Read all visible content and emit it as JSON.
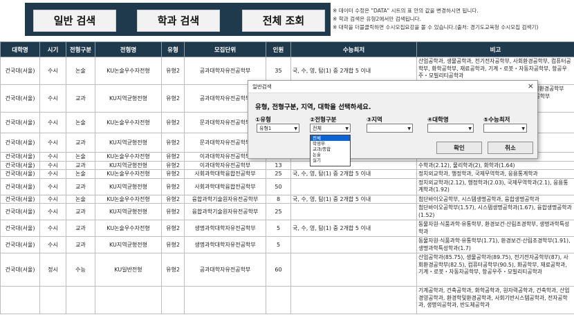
{
  "toolbar": {
    "buttons": [
      {
        "label": "일반 검색"
      },
      {
        "label": "학과 검색"
      },
      {
        "label": "전체 조회"
      }
    ]
  },
  "notes": [
    "※ 데이터 수정은 \"DATA\" 시트의 표 안의 값을 변경하시면 됩니다.",
    "※ 학과 검색은 유형2에서만 검색됩니다.",
    "※ 대학을 더블클릭하면 수시모집요강을 볼 수 있습니다.(출처: 경기도교육청 수시모집 검색기)"
  ],
  "table": {
    "headers": [
      "대학명",
      "시기",
      "전형구분",
      "전형명",
      "유형",
      "모집단위",
      "인원",
      "수능최저",
      "비고"
    ],
    "rows": [
      {
        "cells": [
          "건국대(서울)",
          "수시",
          "논술",
          "KU논술우수자전형",
          "유형2",
          "공과대학자유전공학부",
          "35",
          "국, 수, 영, 탐(1) 중 2개합 5 이내",
          "산업공학과, 생물공학과, 전기전자공학부, 사회환경공학부, 컴퓨터공학부, 화학공학부, 재료공학과, 기계・로봇・자동차공학부, 항공우주・모빌리티공학과"
        ],
        "h": 40
      },
      {
        "cells": [
          "건국대(서울)",
          "수시",
          "교과",
          "KU지역균형전형",
          "유형2",
          "공과대학자유전공학부",
          "",
          "",
          "산업공학과(2.19), 생물공학과, 전기전자공학부, 사회환경공학부(1.75), 화공학부, 재료공학과, 기계・로봇・자동차공학부"
        ],
        "h": 40
      },
      {
        "cells": [
          "건국대(서울)",
          "수시",
          "논술",
          "KU논술우수자전형",
          "유형2",
          "문과대학자유전공학부",
          "",
          "",
          "영어영문학과, 철학과, 사"
        ],
        "h": 30
      },
      {
        "cells": [
          "건국대(서울)",
          "수시",
          "교과",
          "KU지역균형전형",
          "유형2",
          "문과대학자유전공학부",
          "",
          "",
          "지리학과, 커뮤니케이션학과, 미디어중문학과(2.12)"
        ],
        "h": 28
      },
      {
        "cells": [
          "건국대(서울)",
          "수시",
          "논술",
          "KU논술우수자전형",
          "유형2",
          "이과대학자유전공학부",
          "11",
          "국, 수, 영, 탐(1) 중 2개합 5 이내",
          "수학과, 물리학과, 화학과"
        ],
        "h": 11
      },
      {
        "cells": [
          "건국대(서울)",
          "수시",
          "교과",
          "KU지역균형전형",
          "유형2",
          "이과대학자유전공학부",
          "13",
          "",
          "수학과(2.12), 물리학과(2), 화학과(1.64)"
        ],
        "h": 12
      },
      {
        "cells": [
          "건국대(서울)",
          "수시",
          "논술",
          "KU논술우수자전형",
          "유형2",
          "사회과학대학융합전공학부",
          "25",
          "국, 수, 영, 탐(1) 중 2개합 5 이내",
          "정치외교학과, 행정학과, 국제무역학과, 응용통계학과"
        ],
        "h": 12
      },
      {
        "cells": [
          "건국대(서울)",
          "수시",
          "교과",
          "KU지역균형전형",
          "유형2",
          "사회과학대학융합전공학부",
          "50",
          "",
          "정치외교학과(2.12), 행정학과(2.03), 국제무역학과(2.1), 응용통계학과(1.92)"
        ],
        "h": 24
      },
      {
        "cells": [
          "건국대(서울)",
          "수시",
          "논술",
          "KU논술우수자전형",
          "유형2",
          "융합과학기술원자유전공학부",
          "8",
          "국, 수, 영, 탐(1) 중 2개합 5 이내",
          "첨단바이오공학부, 시스템생명공학과, 융합생명공학과"
        ],
        "h": 12
      },
      {
        "cells": [
          "건국대(서울)",
          "수시",
          "교과",
          "KU지역균형전형",
          "유형2",
          "융합과학기술원자유전공학부",
          "25",
          "",
          "첨단바이오공학부(1.57), 시스템생명공학과(1.67), 융합생명공학과(1.52)"
        ],
        "h": 24
      },
      {
        "cells": [
          "건국대(서울)",
          "수시",
          "교과",
          "KU논술우수자전형",
          "유형2",
          "생명과학대학자유전공학부",
          "5",
          "국, 수, 영, 탐(1) 중 2개합 5 이내",
          "동물자원·식품과학·유통학부, 환경보건·산림조경학부, 생명과학특성학과"
        ],
        "h": 24
      },
      {
        "cells": [
          "건국대(서울)",
          "수시",
          "교과",
          "KU지역균형전형",
          "유형2",
          "생명과학대학자유전공학부",
          "5",
          "",
          "동물자원·식품과학·유통학부(1.71), 환경보건·산림조경학부(1.91), 생명과학특성학과(1.7)"
        ],
        "h": 24
      },
      {
        "cells": [
          "건국대(서울)",
          "정시",
          "수능",
          "KU일반전형",
          "유형2",
          "공과대학자유전공학부",
          "60",
          "",
          "산업공학과(85.75), 생물공학과(89.75), 전기전자공학부(87), 사회환경공학부(82.5), 컴퓨터공학부(90.5), 화공학부, 재료공학과, 기계・로봇・자동차공학부, 항공우주・모빌리티공학과"
        ],
        "h": 48
      },
      {
        "cells": [
          "",
          "",
          "",
          "",
          "",
          "",
          "",
          "",
          "기계공학과, 건축공학과, 화학공학과, 원자력공학과, 건축학과, 산업경영공학과, 환경학및환경공학과, 사회기반시스템공학과, 전자공학과, 생명의공학과, 반도체공학과"
        ],
        "h": 40
      }
    ]
  },
  "dialog": {
    "title": "일반검색",
    "close": "×",
    "instruction": "유형, 전형구분, 지역, 대학을 선택하세요.",
    "fields": [
      {
        "label": "①유형",
        "value": "유형1"
      },
      {
        "label": "②전형구분",
        "value": "전체"
      },
      {
        "label": "③지역",
        "value": ""
      },
      {
        "label": "④대학명",
        "value": ""
      },
      {
        "label": "⑤수능최저",
        "value": ""
      }
    ],
    "dropdown_options": [
      "전체",
      "학생부",
      "교과/종합",
      "논술",
      "실기"
    ],
    "selected_option": "전체",
    "ok_label": "확인",
    "cancel_label": "취소"
  }
}
